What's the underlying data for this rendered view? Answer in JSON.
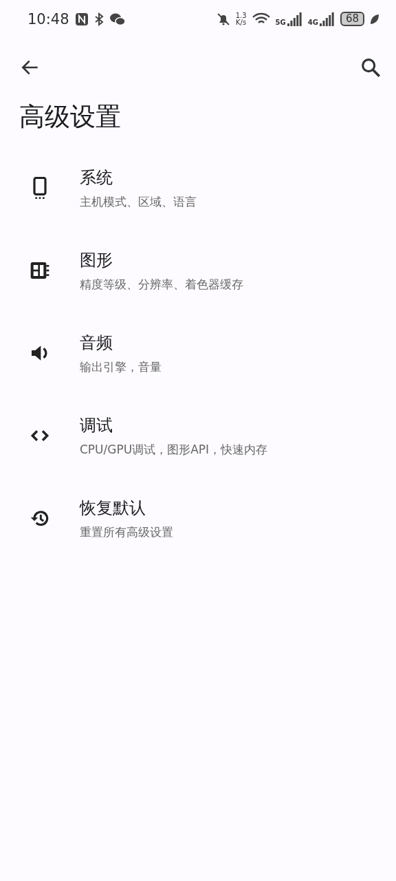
{
  "status_bar": {
    "time": "10:48",
    "speed_value": "1.3",
    "speed_unit": "K/s",
    "network_1": "5G",
    "network_2": "4G",
    "battery": "68"
  },
  "title": "高级设置",
  "items": [
    {
      "kind": "system",
      "title": "系统",
      "subtitle": "主机模式、区域、语言"
    },
    {
      "kind": "graphics",
      "title": "图形",
      "subtitle": "精度等级、分辨率、着色器缓存"
    },
    {
      "kind": "audio",
      "title": "音频",
      "subtitle": "输出引擎，音量"
    },
    {
      "kind": "debug",
      "title": "调试",
      "subtitle": "CPU/GPU调试，图形API，快速内存"
    },
    {
      "kind": "reset",
      "title": "恢复默认",
      "subtitle": "重置所有高级设置"
    }
  ]
}
